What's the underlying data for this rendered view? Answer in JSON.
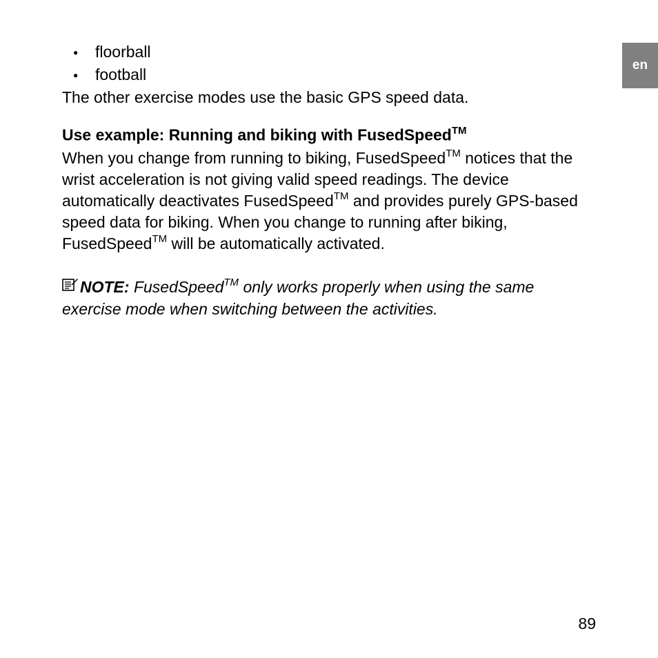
{
  "lang_tab": "en",
  "bullets": {
    "item1": "floorball",
    "item2": "football"
  },
  "para_after_bullets": "The other exercise modes use the basic GPS speed data.",
  "heading": {
    "prefix": "Use example: Running and biking with FusedSpeed",
    "tm": "TM"
  },
  "body": {
    "s1a": "When you change from running to biking, FusedSpeed",
    "tm1": "TM",
    "s1b": " notices that the wrist acceleration is not giving valid speed readings. The device automatically deactivates FusedSpeed",
    "tm2": "TM",
    "s1c": " and provides purely GPS-based speed data for biking. When you change to running after biking, FusedSpeed",
    "tm3": "TM",
    "s1d": " will be automatically activated."
  },
  "note": {
    "label": "NOTE:",
    "t1": " FusedSpeed",
    "tm": "TM",
    "t2": " only works properly when using the same exercise mode when switching between the activities."
  },
  "page_number": "89"
}
